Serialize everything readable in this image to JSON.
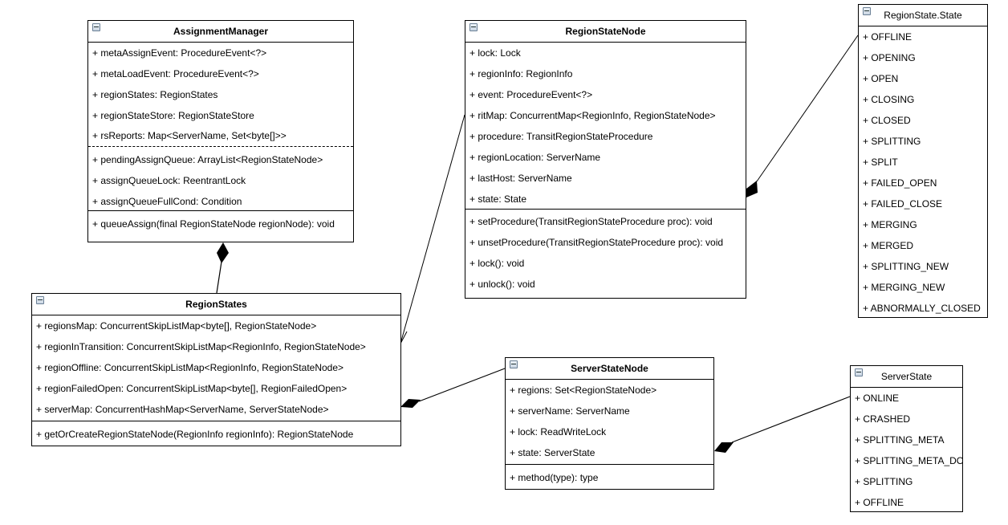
{
  "classes": {
    "assignment_manager": {
      "name": "AssignmentManager",
      "attributes": [
        "+ metaAssignEvent: ProcedureEvent<?>",
        "+ metaLoadEvent: ProcedureEvent<?>",
        "+ regionStates: RegionStates",
        "+ regionStateStore: RegionStateStore",
        "+ rsReports: Map<ServerName, Set<byte[]>>"
      ],
      "attributes2": [
        "+ pendingAssignQueue: ArrayList<RegionStateNode>",
        "+ assignQueueLock: ReentrantLock",
        "+ assignQueueFullCond: Condition"
      ],
      "methods": [
        "+ queueAssign(final RegionStateNode regionNode): void"
      ]
    },
    "region_state_node": {
      "name": "RegionStateNode",
      "attributes": [
        "+ lock: Lock",
        "+ regionInfo: RegionInfo",
        "+ event: ProcedureEvent<?>",
        "+ ritMap: ConcurrentMap<RegionInfo, RegionStateNode>",
        "+ procedure: TransitRegionStateProcedure",
        "+ regionLocation: ServerName",
        "+ lastHost: ServerName",
        "+ state: State"
      ],
      "methods": [
        "+ setProcedure(TransitRegionStateProcedure proc): void",
        "+ unsetProcedure(TransitRegionStateProcedure proc): void",
        "+ lock(): void",
        "+ unlock(): void"
      ]
    },
    "region_state_state": {
      "name": "RegionState.State",
      "values": [
        "+ OFFLINE",
        "+ OPENING",
        "+ OPEN",
        "+ CLOSING",
        "+ CLOSED",
        "+ SPLITTING",
        "+ SPLIT",
        "+ FAILED_OPEN",
        "+ FAILED_CLOSE",
        "+ MERGING",
        "+ MERGED",
        "+ SPLITTING_NEW",
        "+ MERGING_NEW",
        "+ ABNORMALLY_CLOSED"
      ]
    },
    "region_states": {
      "name": "RegionStates",
      "attributes": [
        "+ regionsMap: ConcurrentSkipListMap<byte[], RegionStateNode>",
        "+ regionInTransition: ConcurrentSkipListMap<RegionInfo, RegionStateNode>",
        "+ regionOffline: ConcurrentSkipListMap<RegionInfo, RegionStateNode>",
        "+ regionFailedOpen: ConcurrentSkipListMap<byte[], RegionFailedOpen>",
        "+ serverMap: ConcurrentHashMap<ServerName, ServerStateNode>"
      ],
      "methods": [
        "+ getOrCreateRegionStateNode(RegionInfo regionInfo): RegionStateNode"
      ]
    },
    "server_state_node": {
      "name": "ServerStateNode",
      "attributes": [
        "+ regions: Set<RegionStateNode>",
        "+ serverName: ServerName",
        "+ lock: ReadWriteLock",
        "+ state: ServerState"
      ],
      "methods": [
        "+ method(type): type"
      ]
    },
    "server_state": {
      "name": "ServerState",
      "values": [
        "+ ONLINE",
        "+ CRASHED",
        "+ SPLITTING_META",
        "+ SPLITTING_META_DONE",
        "+ SPLITTING",
        "+ OFFLINE"
      ]
    }
  },
  "relations": [
    {
      "type": "composition",
      "whole": "AssignmentManager",
      "part": "RegionStates"
    },
    {
      "type": "association",
      "from": "RegionStateNode",
      "to": "RegionStates"
    },
    {
      "type": "composition",
      "whole": "RegionStates",
      "part": "ServerStateNode"
    },
    {
      "type": "composition",
      "whole": "RegionStateNode",
      "part": "RegionState.State"
    },
    {
      "type": "composition",
      "whole": "ServerStateNode",
      "part": "ServerState"
    }
  ]
}
